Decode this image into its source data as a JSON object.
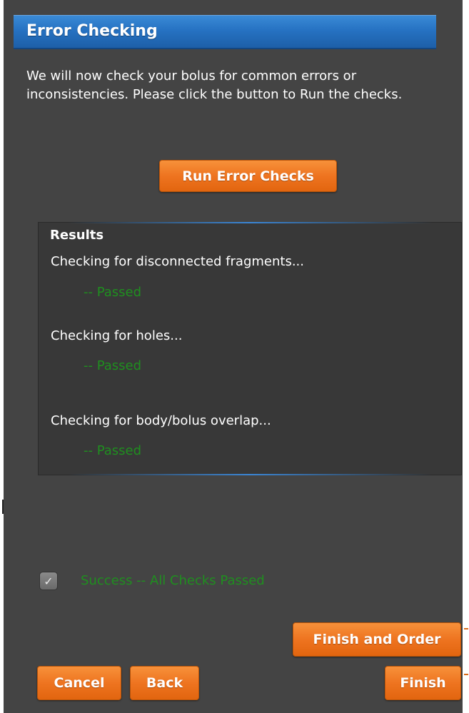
{
  "header": {
    "title": "Error Checking"
  },
  "intro_text": "We will now check your bolus for common errors or inconsistencies. Please click the button to Run the checks.",
  "run_button": {
    "label": "Run Error Checks"
  },
  "results": {
    "title": "Results",
    "checks": [
      {
        "label": "Checking for disconnected fragments...",
        "status": "-- Passed"
      },
      {
        "label": "Checking for holes...",
        "status": "-- Passed"
      },
      {
        "label": "Checking for body/bolus overlap...",
        "status": "-- Passed"
      }
    ]
  },
  "success": {
    "checked": true,
    "label": "Success -- All Checks Passed"
  },
  "footer": {
    "finish_and_order_label": "Finish and Order",
    "cancel_label": "Cancel",
    "back_label": "Back",
    "finish_label": "Finish"
  },
  "colors": {
    "accent_orange": "#ee7420",
    "header_blue": "#2672c2",
    "passed_green": "#1f8f1f",
    "panel_bg": "#444444"
  },
  "icons": {
    "checkbox": "checkmark-icon"
  }
}
